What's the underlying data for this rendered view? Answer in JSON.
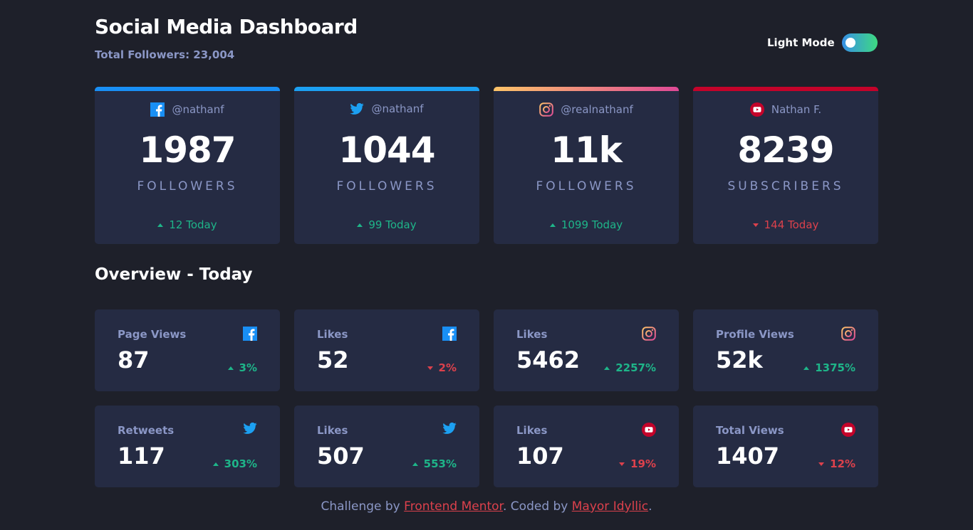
{
  "header": {
    "title": "Social Media Dashboard",
    "total_followers": "Total Followers: 23,004",
    "mode_label": "Light Mode"
  },
  "colors": {
    "background": "#1e202a",
    "card": "#252b43",
    "muted_text": "#8b97c6",
    "up": "#1eb589",
    "down": "#dc414c",
    "facebook": "#198ff5",
    "twitter": "#1ca0f2",
    "instagram_start": "#fdc468",
    "instagram_end": "#df4996",
    "youtube": "#c4032a"
  },
  "cards": [
    {
      "platform": "facebook",
      "icon": "facebook-icon",
      "handle": "@nathanf",
      "count": "1987",
      "unit": "FOLLOWERS",
      "delta": "12 Today",
      "trend": "up"
    },
    {
      "platform": "twitter",
      "icon": "twitter-icon",
      "handle": "@nathanf",
      "count": "1044",
      "unit": "FOLLOWERS",
      "delta": "99 Today",
      "trend": "up"
    },
    {
      "platform": "instagram",
      "icon": "instagram-icon",
      "handle": "@realnathanf",
      "count": "11k",
      "unit": "FOLLOWERS",
      "delta": "1099 Today",
      "trend": "up"
    },
    {
      "platform": "youtube",
      "icon": "youtube-icon",
      "handle": "Nathan F.",
      "count": "8239",
      "unit": "SUBSCRIBERS",
      "delta": "144 Today",
      "trend": "down"
    }
  ],
  "overview": {
    "title": "Overview - Today",
    "tiles": [
      {
        "label": "Page Views",
        "platform": "facebook",
        "icon": "facebook-icon",
        "value": "87",
        "delta": "3%",
        "trend": "up"
      },
      {
        "label": "Likes",
        "platform": "facebook",
        "icon": "facebook-icon",
        "value": "52",
        "delta": "2%",
        "trend": "down"
      },
      {
        "label": "Likes",
        "platform": "instagram",
        "icon": "instagram-icon",
        "value": "5462",
        "delta": "2257%",
        "trend": "up"
      },
      {
        "label": "Profile Views",
        "platform": "instagram",
        "icon": "instagram-icon",
        "value": "52k",
        "delta": "1375%",
        "trend": "up"
      },
      {
        "label": "Retweets",
        "platform": "twitter",
        "icon": "twitter-icon",
        "value": "117",
        "delta": "303%",
        "trend": "up"
      },
      {
        "label": "Likes",
        "platform": "twitter",
        "icon": "twitter-icon",
        "value": "507",
        "delta": "553%",
        "trend": "up"
      },
      {
        "label": "Likes",
        "platform": "youtube",
        "icon": "youtube-icon",
        "value": "107",
        "delta": "19%",
        "trend": "down"
      },
      {
        "label": "Total Views",
        "platform": "youtube",
        "icon": "youtube-icon",
        "value": "1407",
        "delta": "12%",
        "trend": "down"
      }
    ]
  },
  "footer": {
    "prefix": "Challenge by ",
    "link1": "Frontend Mentor",
    "middle": ". Coded by ",
    "link2": "Mayor Idyllic",
    "suffix": "."
  }
}
